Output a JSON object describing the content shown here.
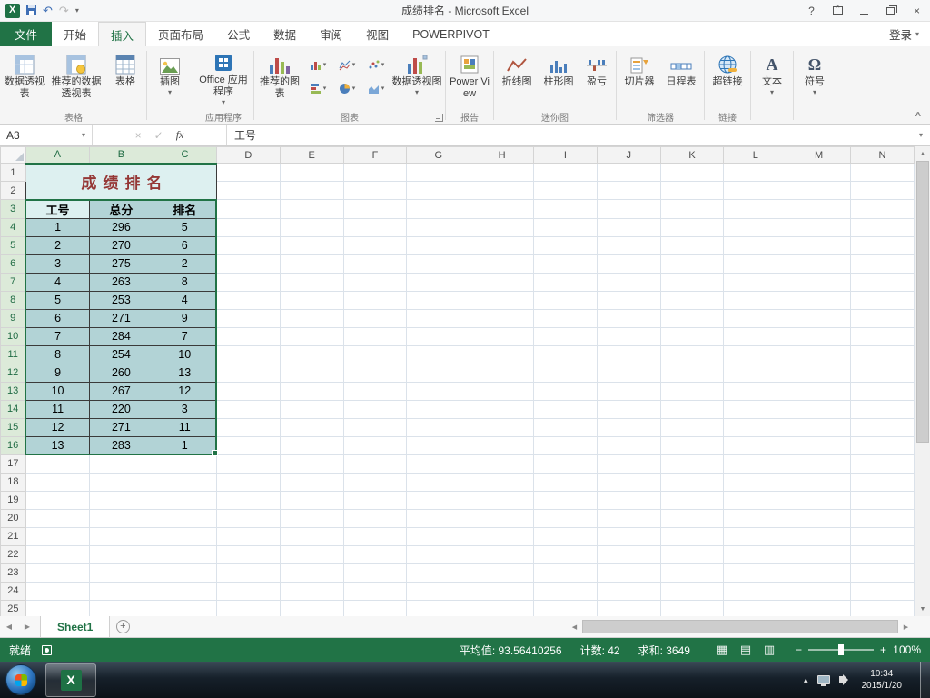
{
  "icons": {
    "dropdown": "▾",
    "up": "▲",
    "down": "▼",
    "left": "◀",
    "right": "▶",
    "help": "?",
    "close": "×",
    "undo": "↶",
    "redo": "↷",
    "check": "✓",
    "cross": "×",
    "fx": "fx",
    "omega": "Ω",
    "letter_a": "A",
    "plus": "+",
    "minus": "−",
    "collapse": "^",
    "tray_up": "▴",
    "view_normal": "▦",
    "view_layout": "▤",
    "view_break": "▥"
  },
  "titlebar": {
    "title": "成绩排名 - Microsoft Excel"
  },
  "tabs": [
    "文件",
    "开始",
    "插入",
    "页面布局",
    "公式",
    "数据",
    "审阅",
    "视图",
    "POWERPIVOT"
  ],
  "sign_in": "登录",
  "ribbon": {
    "pivot_table": "数据透视表",
    "recommended_pivot": "推荐的数据透视表",
    "table": "表格",
    "illustrations": "插图",
    "office_apps": "Office 应用程序",
    "recommended_charts": "推荐的图表",
    "pivot_chart": "数据透视图",
    "power_view": "Power View",
    "spark_line": "折线图",
    "spark_column": "柱形图",
    "spark_winloss": "盈亏",
    "slicer": "切片器",
    "timeline": "日程表",
    "hyperlink": "超链接",
    "text": "文本",
    "symbols": "符号",
    "groups": {
      "tables": "表格",
      "apps": "应用程序",
      "charts": "图表",
      "reports": "报告",
      "sparklines": "迷你图",
      "filters": "筛选器",
      "links": "链接"
    }
  },
  "formula_bar": {
    "name_box": "A3",
    "content": "工号"
  },
  "sheet": {
    "columns": [
      "A",
      "B",
      "C",
      "D",
      "E",
      "F",
      "G",
      "H",
      "I",
      "J",
      "K",
      "L",
      "M",
      "N"
    ],
    "visible_rows": 25,
    "title": "成绩排名",
    "headers": [
      "工号",
      "总分",
      "排名"
    ],
    "rows": [
      [
        1,
        296,
        5
      ],
      [
        2,
        270,
        6
      ],
      [
        3,
        275,
        2
      ],
      [
        4,
        263,
        8
      ],
      [
        5,
        253,
        4
      ],
      [
        6,
        271,
        9
      ],
      [
        7,
        284,
        7
      ],
      [
        8,
        254,
        10
      ],
      [
        9,
        260,
        13
      ],
      [
        10,
        267,
        12
      ],
      [
        11,
        220,
        3
      ],
      [
        12,
        271,
        11
      ],
      [
        13,
        283,
        1
      ]
    ],
    "active_cell": "A3",
    "selected_range": "A3:C16"
  },
  "sheet_bar": {
    "tab": "Sheet1"
  },
  "status_bar": {
    "mode": "就绪",
    "average": "平均值: 93.56410256",
    "count": "计数: 42",
    "sum": "求和: 3649",
    "zoom": "100%"
  },
  "taskbar": {
    "time": "10:34",
    "date": "2015/1/20"
  }
}
